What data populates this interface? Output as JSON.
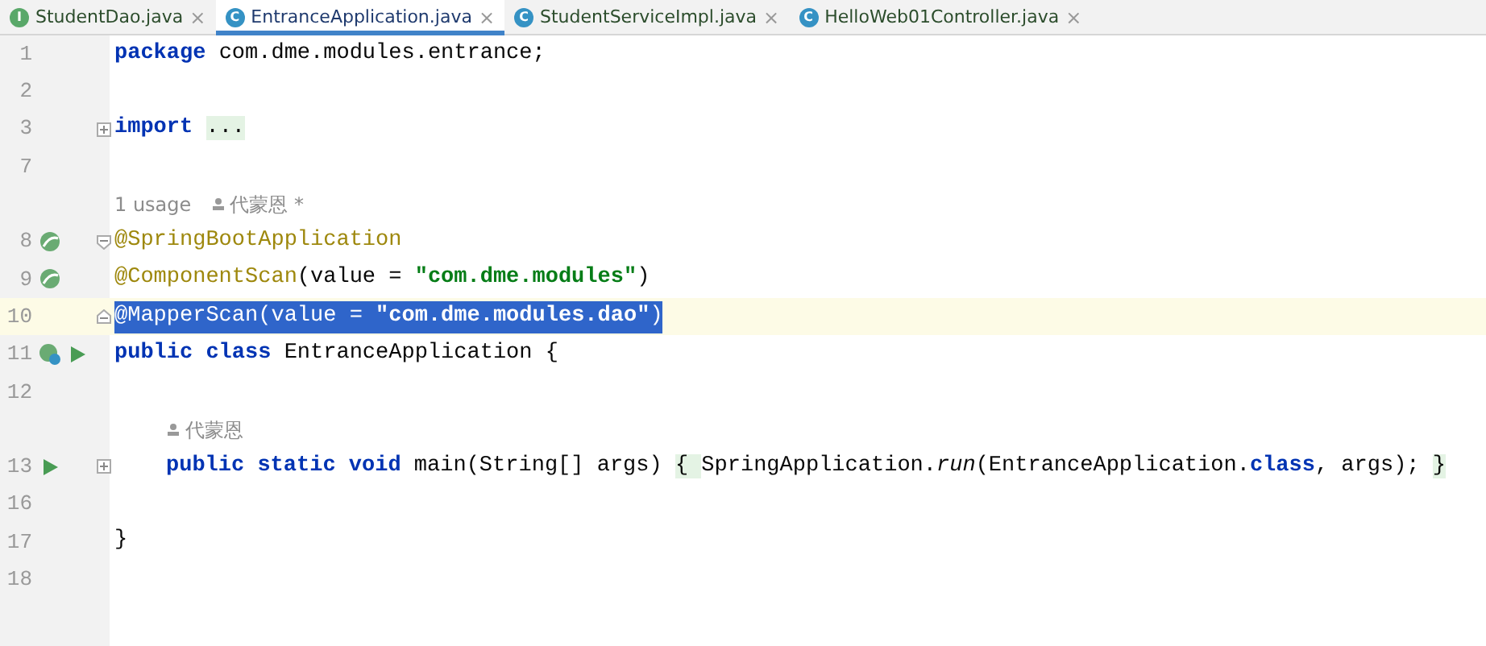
{
  "tabs": [
    {
      "kind": "interface",
      "badge": "I",
      "label": "StudentDao.java",
      "close": "×",
      "selected": false
    },
    {
      "kind": "spring-class",
      "badge": "C",
      "label": "EntranceApplication.java",
      "close": "×",
      "selected": true
    },
    {
      "kind": "class",
      "badge": "C",
      "label": "StudentServiceImpl.java",
      "close": "×",
      "selected": false
    },
    {
      "kind": "class",
      "badge": "C",
      "label": "HelloWeb01Controller.java",
      "close": "×",
      "selected": false
    }
  ],
  "lines": [
    {
      "kind": "code",
      "number": "1",
      "current": false,
      "tokens": [
        {
          "kind": "kw",
          "s": "package"
        },
        {
          "kind": "plain",
          "s": " com.dme.modules.entrance;"
        }
      ]
    },
    {
      "kind": "code",
      "number": "2",
      "current": false
    },
    {
      "kind": "code",
      "number": "3",
      "current": false,
      "markers": [
        {
          "kind": "fold-collapsed"
        }
      ],
      "tokens": [
        {
          "kind": "kw",
          "s": "import "
        },
        {
          "kind": "folded",
          "s": "..."
        }
      ]
    },
    {
      "kind": "code",
      "number": "7",
      "current": false
    },
    {
      "kind": "hint",
      "usage": "1 usage",
      "author": "代蒙恩 *"
    },
    {
      "kind": "code",
      "number": "8",
      "current": false,
      "markers": [
        {
          "kind": "bean"
        },
        {
          "kind": "fold-open"
        }
      ],
      "tokens": [
        {
          "kind": "ann",
          "s": "@SpringBootApplication"
        }
      ]
    },
    {
      "kind": "code",
      "number": "9",
      "current": false,
      "markers": [
        {
          "kind": "bean"
        }
      ],
      "tokens": [
        {
          "kind": "ann",
          "s": "@ComponentScan"
        },
        {
          "kind": "plain",
          "s": "(value = "
        },
        {
          "kind": "str",
          "s": "\"com.dme.modules\""
        },
        {
          "kind": "plain",
          "s": ")"
        }
      ]
    },
    {
      "kind": "code",
      "number": "10",
      "current": true,
      "selected": true,
      "markers": [
        {
          "kind": "fold-end"
        }
      ],
      "tokens": [
        {
          "kind": "ann",
          "s": "@MapperScan"
        },
        {
          "kind": "plain",
          "s": "(value = "
        },
        {
          "kind": "str",
          "s": "\"com.dme.modules.dao\""
        },
        {
          "kind": "plain",
          "s": ")"
        }
      ]
    },
    {
      "kind": "code",
      "number": "11",
      "current": false,
      "markers": [
        {
          "kind": "bean-class"
        },
        {
          "kind": "run"
        }
      ],
      "tokens": [
        {
          "kind": "kw",
          "s": "public class"
        },
        {
          "kind": "plain",
          "s": " EntranceApplication {"
        }
      ]
    },
    {
      "kind": "code",
      "number": "12",
      "current": false
    },
    {
      "kind": "indented-hint",
      "author": "代蒙恩"
    },
    {
      "kind": "indented-code",
      "number": "13",
      "current": false,
      "markers": [
        {
          "kind": "run"
        },
        {
          "kind": "fold-collapsed"
        }
      ],
      "tokens": [
        {
          "kind": "kw",
          "s": "public static void"
        },
        {
          "kind": "plain",
          "s": " main(String[] args) "
        },
        {
          "kind": "folded",
          "s": "{ "
        },
        {
          "kind": "plain",
          "s": "SpringApplication."
        },
        {
          "kind": "it",
          "s": "run"
        },
        {
          "kind": "plain",
          "s": "(EntranceApplication."
        },
        {
          "kind": "kw",
          "s": "class"
        },
        {
          "kind": "plain",
          "s": ", args); "
        },
        {
          "kind": "folded",
          "s": "}"
        }
      ]
    },
    {
      "kind": "code",
      "number": "16",
      "current": false
    },
    {
      "kind": "code",
      "number": "17",
      "current": false,
      "tokens": [
        {
          "kind": "plain",
          "s": "}"
        }
      ]
    },
    {
      "kind": "code",
      "number": "18",
      "current": false
    }
  ]
}
